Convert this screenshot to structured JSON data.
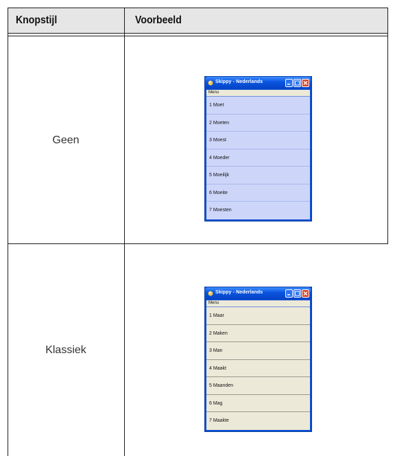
{
  "table": {
    "header": {
      "col1": "Knopstijl",
      "col2": "Voorbeeld"
    },
    "rows": [
      {
        "style": "Geen",
        "window": {
          "title": "Skippy - Nederlands",
          "menu": "Menu",
          "items": [
            "1 Moet",
            "2 Moeten",
            "3 Moest",
            "4 Moeder",
            "5 Moeilijk",
            "6 Moeite",
            "7 Moesten"
          ]
        }
      },
      {
        "style": "Klassiek",
        "window": {
          "title": "Skippy - Nederlands",
          "menu": "Menu",
          "items": [
            "1 Maar",
            "2 Maken",
            "3 Man",
            "4 Maakt",
            "5 Maanden",
            "6 Mag",
            "7 Maakte"
          ]
        }
      }
    ]
  },
  "colors": {
    "titlebar": "#0a55e0",
    "close_button": "#d9462b",
    "items_blue": "#cdd6f9",
    "items_classic": "#ece9d8"
  }
}
